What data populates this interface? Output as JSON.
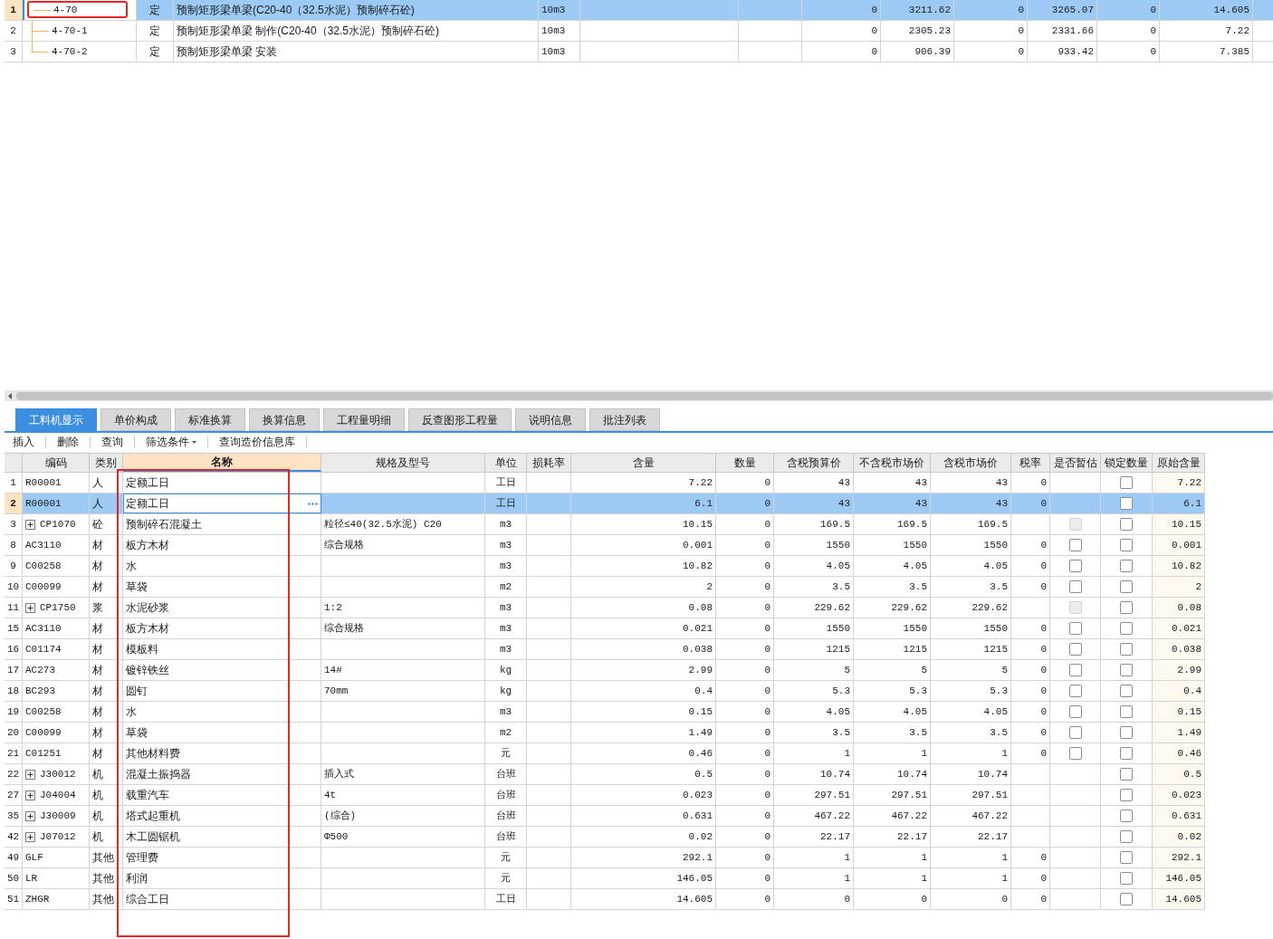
{
  "top_table": {
    "rows": [
      {
        "number": "1",
        "code": "4-70",
        "type": "定",
        "name": "预制矩形梁单梁(C20-40（32.5水泥）预制碎石砼)",
        "unit": "10m3",
        "values": [
          "0",
          "3211.62",
          "0",
          "3265.07",
          "0",
          "14.605"
        ],
        "selected": true,
        "children": [
          {
            "number": "2",
            "code": "4-70-1",
            "type": "定",
            "name": "预制矩形梁单梁 制作(C20-40（32.5水泥）预制碎石砼)",
            "unit": "10m3",
            "values": [
              "0",
              "2305.23",
              "0",
              "2331.66",
              "0",
              "7.22"
            ],
            "selected": false
          },
          {
            "number": "3",
            "code": "4-70-2",
            "type": "定",
            "name": "预制矩形梁单梁 安装",
            "unit": "10m3",
            "values": [
              "0",
              "906.39",
              "0",
              "933.42",
              "0",
              "7.385"
            ],
            "selected": false
          }
        ]
      }
    ]
  },
  "tabs": [
    {
      "label": "工料机显示",
      "selected": true
    },
    {
      "label": "单价构成",
      "selected": false
    },
    {
      "label": "标准换算",
      "selected": false
    },
    {
      "label": "换算信息",
      "selected": false
    },
    {
      "label": "工程量明细",
      "selected": false
    },
    {
      "label": "反查图形工程量",
      "selected": false
    },
    {
      "label": "说明信息",
      "selected": false
    },
    {
      "label": "批注列表",
      "selected": false
    }
  ],
  "toolbar": [
    {
      "label": "插入",
      "kind": "button"
    },
    {
      "label": "删除",
      "kind": "button"
    },
    {
      "label": "查询",
      "kind": "button"
    },
    {
      "label": "筛选条件",
      "kind": "dropdown"
    },
    {
      "label": "查询造价信息库",
      "kind": "button"
    }
  ],
  "grid": {
    "columns": [
      {
        "label": "编码",
        "selected": false
      },
      {
        "label": "类别",
        "selected": false
      },
      {
        "label": "名称",
        "selected": true
      },
      {
        "label": "规格及型号",
        "selected": false
      },
      {
        "label": "单位",
        "selected": false
      },
      {
        "label": "损耗率",
        "selected": false
      },
      {
        "label": "含量",
        "selected": false
      },
      {
        "label": "数量",
        "selected": false
      },
      {
        "label": "含税预算价",
        "selected": false
      },
      {
        "label": "不含税市场价",
        "selected": false
      },
      {
        "label": "含税市场价",
        "selected": false
      },
      {
        "label": "税率",
        "selected": false
      },
      {
        "label": "是否暂估",
        "selected": false
      },
      {
        "label": "锁定数量",
        "selected": false
      },
      {
        "label": "原始含量",
        "selected": false
      }
    ],
    "rows": [
      {
        "number": "1",
        "code": "R00001",
        "category": "人",
        "name": "定额工日",
        "unit": "工日",
        "content": "7.22",
        "quantity": "0",
        "budget_price": "43",
        "market_price_ex_tax": "43",
        "market_price": "43",
        "tax_rate": "0",
        "locked": {
          "checked": false
        },
        "original_content": "7.22",
        "selected": false
      },
      {
        "number": "2",
        "code": "R00001",
        "category": "人",
        "name": "定额工日",
        "unit": "工日",
        "content": "6.1",
        "quantity": "0",
        "budget_price": "43",
        "market_price_ex_tax": "43",
        "market_price": "43",
        "tax_rate": "0",
        "locked": {
          "checked": false
        },
        "original_content": "6.1",
        "selected": true
      },
      {
        "number": "3",
        "code": "CP1070",
        "expanded": false,
        "category": "砼",
        "name": "预制碎石混凝土",
        "spec": "粒径≤40(32.5水泥) C20",
        "unit": "m3",
        "content": "10.15",
        "quantity": "0",
        "budget_price": "169.5",
        "market_price_ex_tax": "169.5",
        "market_price": "169.5",
        "provisional": {
          "checked": false,
          "disabled": true
        },
        "locked": {
          "checked": false
        },
        "original_content": "10.15",
        "selected": false
      },
      {
        "number": "8",
        "code": "AC3110",
        "category": "材",
        "name": "板方木材",
        "spec": "综合规格",
        "unit": "m3",
        "content": "0.001",
        "quantity": "0",
        "budget_price": "1550",
        "market_price_ex_tax": "1550",
        "market_price": "1550",
        "tax_rate": "0",
        "provisional": {
          "checked": false,
          "disabled": false
        },
        "locked": {
          "checked": false
        },
        "original_content": "0.001",
        "selected": false
      },
      {
        "number": "9",
        "code": "C00258",
        "category": "材",
        "name": "水",
        "unit": "m3",
        "content": "10.82",
        "quantity": "0",
        "budget_price": "4.05",
        "market_price_ex_tax": "4.05",
        "market_price": "4.05",
        "tax_rate": "0",
        "provisional": {
          "checked": false,
          "disabled": false
        },
        "locked": {
          "checked": false
        },
        "original_content": "10.82",
        "selected": false
      },
      {
        "number": "10",
        "code": "C00099",
        "category": "材",
        "name": "草袋",
        "unit": "m2",
        "content": "2",
        "quantity": "0",
        "budget_price": "3.5",
        "market_price_ex_tax": "3.5",
        "market_price": "3.5",
        "tax_rate": "0",
        "provisional": {
          "checked": false,
          "disabled": false
        },
        "locked": {
          "checked": false
        },
        "original_content": "2",
        "selected": false
      },
      {
        "number": "11",
        "code": "CP1750",
        "expanded": false,
        "category": "浆",
        "name": "水泥砂浆",
        "spec": "1:2",
        "unit": "m3",
        "content": "0.08",
        "quantity": "0",
        "budget_price": "229.62",
        "market_price_ex_tax": "229.62",
        "market_price": "229.62",
        "provisional": {
          "checked": false,
          "disabled": true
        },
        "locked": {
          "checked": false
        },
        "original_content": "0.08",
        "selected": false
      },
      {
        "number": "15",
        "code": "AC3110",
        "category": "材",
        "name": "板方木材",
        "spec": "综合规格",
        "unit": "m3",
        "content": "0.021",
        "quantity": "0",
        "budget_price": "1550",
        "market_price_ex_tax": "1550",
        "market_price": "1550",
        "tax_rate": "0",
        "provisional": {
          "checked": false,
          "disabled": false
        },
        "locked": {
          "checked": false
        },
        "original_content": "0.021",
        "selected": false
      },
      {
        "number": "16",
        "code": "C01174",
        "category": "材",
        "name": "模板料",
        "unit": "m3",
        "content": "0.038",
        "quantity": "0",
        "budget_price": "1215",
        "market_price_ex_tax": "1215",
        "market_price": "1215",
        "tax_rate": "0",
        "provisional": {
          "checked": false,
          "disabled": false
        },
        "locked": {
          "checked": false
        },
        "original_content": "0.038",
        "selected": false
      },
      {
        "number": "17",
        "code": "AC273",
        "category": "材",
        "name": "镀锌铁丝",
        "spec": "14#",
        "unit": "kg",
        "content": "2.99",
        "quantity": "0",
        "budget_price": "5",
        "market_price_ex_tax": "5",
        "market_price": "5",
        "tax_rate": "0",
        "provisional": {
          "checked": false,
          "disabled": false
        },
        "locked": {
          "checked": false
        },
        "original_content": "2.99",
        "selected": false
      },
      {
        "number": "18",
        "code": "BC293",
        "category": "材",
        "name": "圆钉",
        "spec": "70mm",
        "unit": "kg",
        "content": "0.4",
        "quantity": "0",
        "budget_price": "5.3",
        "market_price_ex_tax": "5.3",
        "market_price": "5.3",
        "tax_rate": "0",
        "provisional": {
          "checked": false,
          "disabled": false
        },
        "locked": {
          "checked": false
        },
        "original_content": "0.4",
        "selected": false
      },
      {
        "number": "19",
        "code": "C00258",
        "category": "材",
        "name": "水",
        "unit": "m3",
        "content": "0.15",
        "quantity": "0",
        "budget_price": "4.05",
        "market_price_ex_tax": "4.05",
        "market_price": "4.05",
        "tax_rate": "0",
        "provisional": {
          "checked": false,
          "disabled": false
        },
        "locked": {
          "checked": false
        },
        "original_content": "0.15",
        "selected": false
      },
      {
        "number": "20",
        "code": "C00099",
        "category": "材",
        "name": "草袋",
        "unit": "m2",
        "content": "1.49",
        "quantity": "0",
        "budget_price": "3.5",
        "market_price_ex_tax": "3.5",
        "market_price": "3.5",
        "tax_rate": "0",
        "provisional": {
          "checked": false,
          "disabled": false
        },
        "locked": {
          "checked": false
        },
        "original_content": "1.49",
        "selected": false
      },
      {
        "number": "21",
        "code": "C01251",
        "category": "材",
        "name": "其他材料费",
        "unit": "元",
        "content": "0.46",
        "quantity": "0",
        "budget_price": "1",
        "market_price_ex_tax": "1",
        "market_price": "1",
        "tax_rate": "0",
        "provisional": {
          "checked": false,
          "disabled": false
        },
        "locked": {
          "checked": false
        },
        "original_content": "0.46",
        "selected": false
      },
      {
        "number": "22",
        "code": "J30012",
        "expanded": false,
        "category": "机",
        "name": "混凝土振捣器",
        "spec": "插入式",
        "unit": "台班",
        "content": "0.5",
        "quantity": "0",
        "budget_price": "10.74",
        "market_price_ex_tax": "10.74",
        "market_price": "10.74",
        "locked": {
          "checked": false
        },
        "original_content": "0.5",
        "selected": false
      },
      {
        "number": "27",
        "code": "J04004",
        "expanded": false,
        "category": "机",
        "name": "载重汽车",
        "spec": "4t",
        "unit": "台班",
        "content": "0.023",
        "quantity": "0",
        "budget_price": "297.51",
        "market_price_ex_tax": "297.51",
        "market_price": "297.51",
        "locked": {
          "checked": false
        },
        "original_content": "0.023",
        "selected": false
      },
      {
        "number": "35",
        "code": "J30009",
        "expanded": false,
        "category": "机",
        "name": "塔式起重机",
        "spec": "(综合)",
        "unit": "台班",
        "content": "0.631",
        "quantity": "0",
        "budget_price": "467.22",
        "market_price_ex_tax": "467.22",
        "market_price": "467.22",
        "locked": {
          "checked": false
        },
        "original_content": "0.631",
        "selected": false
      },
      {
        "number": "42",
        "code": "J07012",
        "expanded": false,
        "category": "机",
        "name": "木工圆锯机",
        "spec": "Φ500",
        "unit": "台班",
        "content": "0.02",
        "quantity": "0",
        "budget_price": "22.17",
        "market_price_ex_tax": "22.17",
        "market_price": "22.17",
        "locked": {
          "checked": false
        },
        "original_content": "0.02",
        "selected": false
      },
      {
        "number": "49",
        "code": "GLF",
        "category": "其他",
        "name": "管理费",
        "unit": "元",
        "content": "292.1",
        "quantity": "0",
        "budget_price": "1",
        "market_price_ex_tax": "1",
        "market_price": "1",
        "tax_rate": "0",
        "locked": {
          "checked": false
        },
        "original_content": "292.1",
        "selected": false
      },
      {
        "number": "50",
        "code": "LR",
        "category": "其他",
        "name": "利润",
        "unit": "元",
        "content": "146.05",
        "quantity": "0",
        "budget_price": "1",
        "market_price_ex_tax": "1",
        "market_price": "1",
        "tax_rate": "0",
        "locked": {
          "checked": false
        },
        "original_content": "146.05",
        "selected": false
      },
      {
        "number": "51",
        "code": "ZHGR",
        "category": "其他",
        "name": "综合工日",
        "unit": "工日",
        "content": "14.605",
        "quantity": "0",
        "budget_price": "0",
        "market_price_ex_tax": "0",
        "market_price": "0",
        "tax_rate": "0",
        "locked": {
          "checked": false
        },
        "original_content": "14.605",
        "selected": false
      }
    ]
  }
}
